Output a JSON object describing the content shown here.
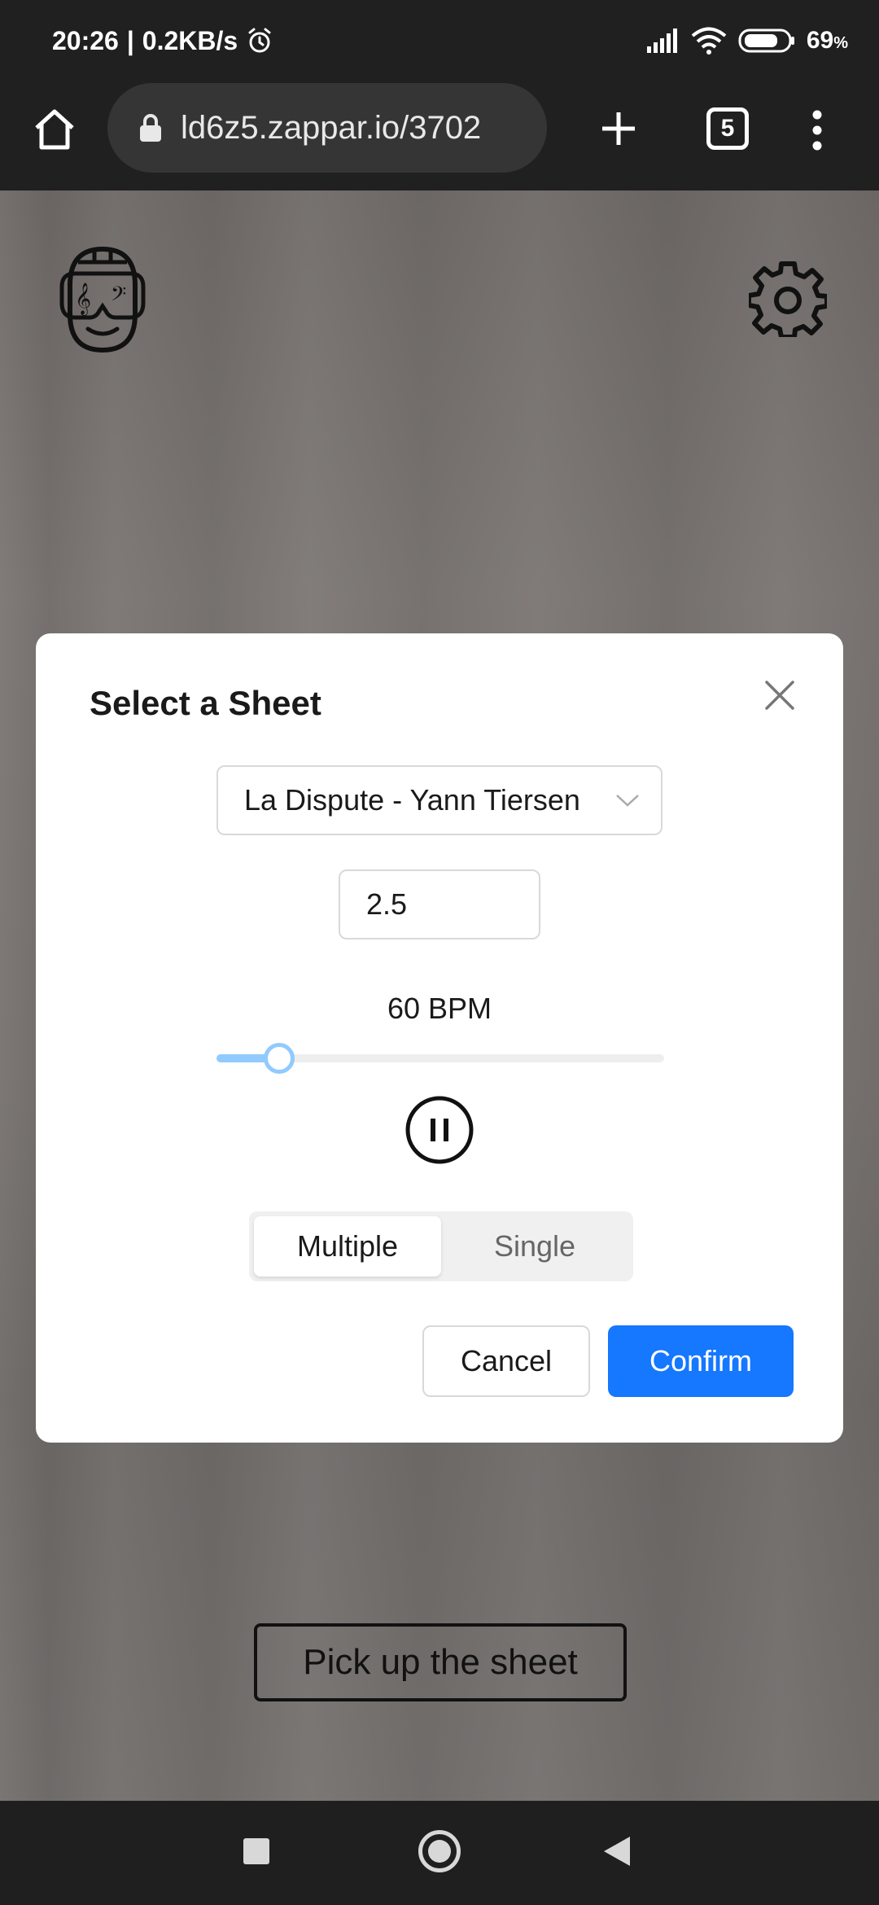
{
  "status_bar": {
    "time": "20:26",
    "separator": "|",
    "net_speed": "0.2KB/s",
    "battery": "69",
    "battery_unit": "%",
    "icons": [
      "alarm-icon",
      "signal-icon",
      "wifi-icon",
      "battery-icon"
    ]
  },
  "browser": {
    "url": "ld6z5.zappar.io/3702",
    "tab_count": "5",
    "icons": [
      "home-icon",
      "lock-icon",
      "plus-icon",
      "tabs-icon",
      "more-vert-icon"
    ]
  },
  "app": {
    "logo_icon": "music-face-icon",
    "settings_icon": "gear-icon"
  },
  "modal": {
    "title": "Select a Sheet",
    "sheet_selected": "La Dispute - Yann Tiersen",
    "number_value": "2.5",
    "bpm_label": "60 BPM",
    "tempo_slider_fraction": 0.14,
    "modes": [
      "Multiple",
      "Single"
    ],
    "active_mode": "Multiple",
    "cancel_label": "Cancel",
    "confirm_label": "Confirm",
    "accent_color": "#1677ff",
    "slider_color": "#91caff"
  },
  "bottom": {
    "pickup_label": "Pick up the sheet"
  },
  "nav_bar": {
    "icons": [
      "recent-apps-icon",
      "home-circle-icon",
      "back-icon"
    ]
  }
}
